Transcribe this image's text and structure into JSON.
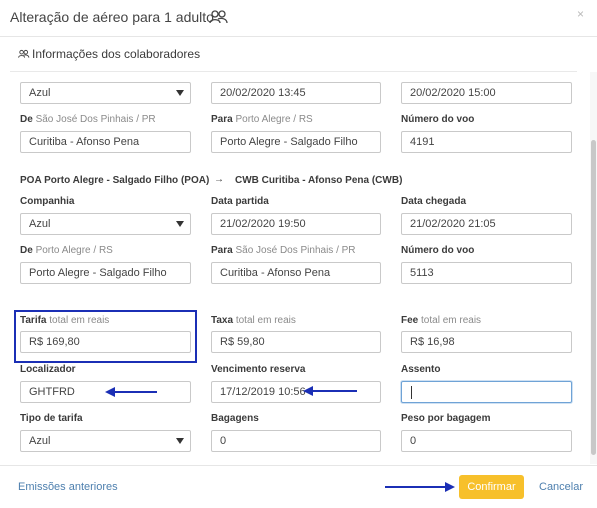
{
  "header": {
    "title": "Alteração de aéreo para 1 adulto",
    "close_symbol": "×"
  },
  "section": {
    "title": "Informações dos colaboradores"
  },
  "segment1": {
    "company": "Azul",
    "departure": "20/02/2020 13:45",
    "arrival": "20/02/2020 15:00",
    "from_label": "De",
    "from_sub": "São José Dos Pinhais / PR",
    "from_value": "Curitiba - Afonso Pena",
    "to_label": "Para",
    "to_sub": "Porto Alegre / RS",
    "to_value": "Porto Alegre - Salgado Filho",
    "flight_label": "Número do voo",
    "flight_value": "4191"
  },
  "route2": {
    "origin": "POA Porto Alegre - Salgado Filho (POA)",
    "arrow": "→",
    "destination": "CWB Curitiba - Afonso Pena (CWB)"
  },
  "segment2": {
    "company_label": "Companhia",
    "company": "Azul",
    "departure_label": "Data partida",
    "departure": "21/02/2020 19:50",
    "arrival_label": "Data chegada",
    "arrival": "21/02/2020 21:05",
    "from_label": "De",
    "from_sub": "Porto Alegre / RS",
    "from_value": "Porto Alegre - Salgado Filho",
    "to_label": "Para",
    "to_sub": "São José Dos Pinhais / PR",
    "to_value": "Curitiba - Afonso Pena",
    "flight_label": "Número do voo",
    "flight_value": "5113"
  },
  "pricing": {
    "tarifa_label": "Tarifa",
    "tarifa_sub": "total em reais",
    "tarifa_value": "R$ 169,80",
    "taxa_label": "Taxa",
    "taxa_sub": "total em reais",
    "taxa_value": "R$ 59,80",
    "fee_label": "Fee",
    "fee_sub": "total em reais",
    "fee_value": "R$ 16,98"
  },
  "booking": {
    "localizador_label": "Localizador",
    "localizador_value": "GHTFRD",
    "vencimento_label": "Vencimento reserva",
    "vencimento_value": "17/12/2019 10:56",
    "assento_label": "Assento",
    "assento_value": ""
  },
  "fare": {
    "tipo_label": "Tipo de tarifa",
    "tipo_value": "Azul",
    "bagagens_label": "Bagagens",
    "bagagens_value": "0",
    "peso_label": "Peso por bagagem",
    "peso_value": "0"
  },
  "footer": {
    "previous_label": "Emissões anteriores",
    "confirm_label": "Confirmar",
    "cancel_label": "Cancelar"
  },
  "colors": {
    "confirm_bg": "#f7c02b",
    "link": "#4d7fae",
    "annotation": "#1b2fb5"
  },
  "icons": {
    "title_icon": "users-icon",
    "section_icon": "users-icon",
    "close": "close-icon"
  }
}
